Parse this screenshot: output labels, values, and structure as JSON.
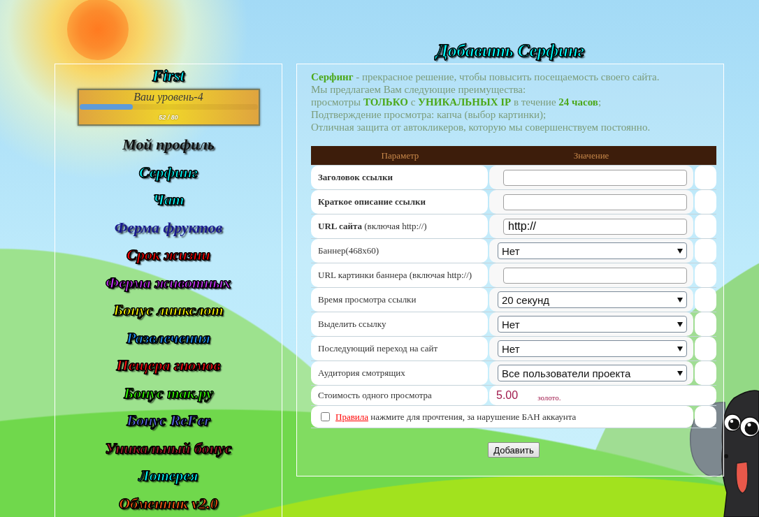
{
  "sidebar": {
    "username": "First",
    "level": {
      "label": "Ваш уровень-4",
      "level": 0.3,
      "reading": "52 / 80"
    },
    "menu": [
      {
        "label": "Мой профиль",
        "color": "#111111"
      },
      {
        "label": "Серфинг",
        "color": "#00ffff"
      },
      {
        "label": "Чат",
        "color": "#00ffff"
      },
      {
        "label": "Ферма фруктов",
        "color": "#1a1a8c"
      },
      {
        "label": "Срок жизни",
        "color": "#ff0000"
      },
      {
        "label": "Ферма животных",
        "color": "#cc33ff"
      },
      {
        "label": "Бонус линкслот",
        "color": "#ffff00"
      },
      {
        "label": "Развлечения",
        "color": "#2299ff"
      },
      {
        "label": "Пещера гномов",
        "color": "#ff1111"
      },
      {
        "label": "Бонус так.ру",
        "color": "#33ff00"
      },
      {
        "label": "Бонус ReFer",
        "color": "#5566dd"
      },
      {
        "label": "Уникальный бонус",
        "color": "#aa1f2a"
      },
      {
        "label": "Лотерея",
        "color": "#00ffff"
      },
      {
        "label": "Обменник v2.0",
        "color": "#ff5a14"
      }
    ]
  },
  "page_title": "Добавить Серфинг",
  "intro": [
    "**Серфинг** - прекрасное решение, чтобы повысить посещаемость своего сайта.",
    "Мы предлагаем Вам следующие преимущества:",
    "просмотры **ТОЛЬКО** с **УНИКАЛЬНЫХ IP** в течение **24 часов**;",
    "Подтверждение просмотра: капча (выбор картинки);",
    "Отличная защита от автокликеров, которую мы совершенствуем постоянно."
  ],
  "form": {
    "columns": [
      "Параметр",
      "Значение"
    ],
    "rows": [
      {
        "kind": "input",
        "label": "Заголовок ссылки",
        "bold": true
      },
      {
        "kind": "input",
        "label": "Краткое описание ссылки",
        "bold": true
      },
      {
        "kind": "input",
        "label": "**URL сайта** (включая http://)",
        "bold": false,
        "value": "http://"
      },
      {
        "kind": "select",
        "label": "Баннер(468x60)",
        "bold": false,
        "value": "Нет"
      },
      {
        "kind": "input",
        "label": "URL картинки баннера (включая http://)",
        "bold": false
      },
      {
        "kind": "select",
        "label": "Время просмотра ссылки",
        "bold": false,
        "value": "20 секунд"
      },
      {
        "kind": "select",
        "label": "Выделить ссылку",
        "bold": false,
        "value": "Нет"
      },
      {
        "kind": "select",
        "label": "Последующий переход на сайт",
        "bold": false,
        "value": "Нет"
      },
      {
        "kind": "select",
        "label": "Аудитория смотрящих",
        "bold": false,
        "value": "Все пользователи проекта"
      },
      {
        "kind": "price",
        "label": "Стоимость одного просмотра",
        "bold": false,
        "value": "5.00",
        "unit": "золото."
      }
    ],
    "rules": {
      "checked": false,
      "link": "Правила",
      "text": "нажмите для прочтения, за нарушение БАН аккаунта"
    },
    "submit": "Добавить"
  }
}
